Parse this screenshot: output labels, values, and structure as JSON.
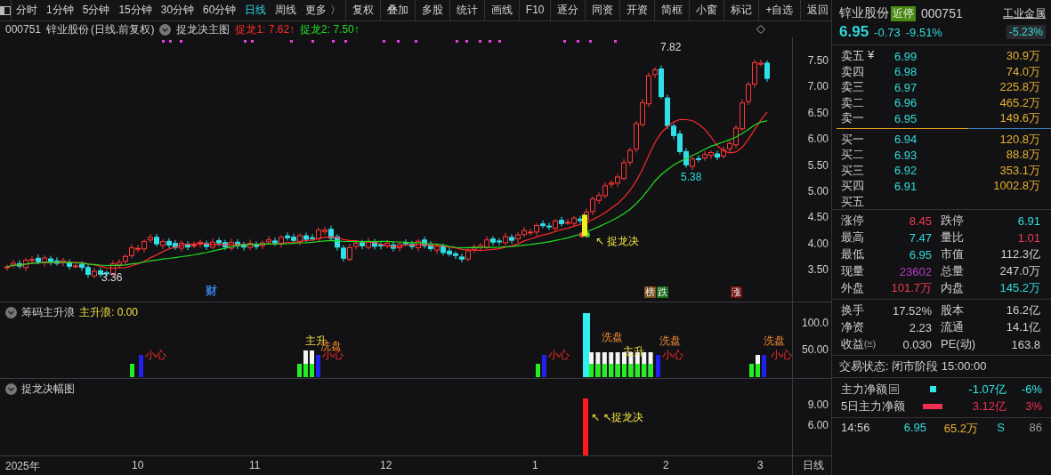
{
  "toolbar": {
    "periods": [
      {
        "label": "分时",
        "selected": false
      },
      {
        "label": "1分钟",
        "selected": false
      },
      {
        "label": "5分钟",
        "selected": false
      },
      {
        "label": "15分钟",
        "selected": false
      },
      {
        "label": "30分钟",
        "selected": false
      },
      {
        "label": "60分钟",
        "selected": false
      },
      {
        "label": "日线",
        "selected": true
      },
      {
        "label": "周线",
        "selected": false
      },
      {
        "label": "更多 〉",
        "selected": false
      }
    ],
    "buttons": [
      "复权",
      "叠加",
      "多股",
      "统计",
      "画线",
      "F10",
      "逐分",
      "同资",
      "开资",
      "简框",
      "小窗",
      "标记",
      "+自选",
      "返回"
    ]
  },
  "chart_header": {
    "code": "000751",
    "name": "锌业股份",
    "mode": "(日线.前复权)",
    "indicator": "捉龙决主图",
    "legend": [
      {
        "label": "捉龙1: 7.62↑",
        "color": "#ff2a2a"
      },
      {
        "label": "捉龙2: 7.50↑",
        "color": "#22dd22"
      }
    ]
  },
  "main_chart": {
    "yticks": [
      "7.50",
      "7.00",
      "6.50",
      "6.00",
      "5.50",
      "5.00",
      "4.50",
      "4.00",
      "3.50"
    ],
    "annotations": [
      {
        "text": "7.82"
      },
      {
        "text": "5.38"
      },
      {
        "text": "3.36"
      },
      {
        "text": "↖ 捉龙决"
      }
    ],
    "markers": [
      {
        "text": "财",
        "kind": "text",
        "color": "#3a7ee0"
      },
      {
        "text": "榜",
        "kind": "badge",
        "color": "#7a4e1c"
      },
      {
        "text": "跌",
        "kind": "badge",
        "color": "#1c6e1c"
      },
      {
        "text": "涨",
        "kind": "badge",
        "color": "#6e1010"
      }
    ]
  },
  "indicator_1": {
    "title": "筹码主升浪",
    "reading": "主升浪: 0.00",
    "yticks": [
      "100.0",
      "50.00"
    ],
    "labels": [
      {
        "text": "小心",
        "kind": "warn"
      },
      {
        "text": "主升",
        "kind": "rise"
      },
      {
        "text": "洗盘",
        "kind": "wash"
      },
      {
        "text": "小心",
        "kind": "warn"
      },
      {
        "text": "小心",
        "kind": "warn"
      },
      {
        "text": "洗盘",
        "kind": "wash"
      },
      {
        "text": "主升",
        "kind": "rise"
      },
      {
        "text": "洗盘",
        "kind": "wash"
      },
      {
        "text": "小心",
        "kind": "warn"
      },
      {
        "text": "洗盘",
        "kind": "wash"
      },
      {
        "text": "小心",
        "kind": "warn"
      }
    ]
  },
  "indicator_2": {
    "title": "捉龙决幅图",
    "yticks": [
      "9.00",
      "6.00"
    ],
    "annotation": "↖ ↖捉龙决"
  },
  "x_axis": {
    "labels": [
      "2025年",
      "10",
      "11",
      "12",
      "1",
      "2",
      "3"
    ],
    "period": "日线"
  },
  "quote": {
    "name": "锌业股份",
    "badge": "近停",
    "code": "000751",
    "sector": "工业金属",
    "sector_change": "-5.23%",
    "price": "6.95",
    "change": "-0.73",
    "percent": "-9.51%",
    "asks": [
      {
        "label": "卖五",
        "price": "6.99",
        "volume": "30.9万"
      },
      {
        "label": "卖四",
        "price": "6.98",
        "volume": "74.0万"
      },
      {
        "label": "卖三",
        "price": "6.97",
        "volume": "225.8万"
      },
      {
        "label": "卖二",
        "price": "6.96",
        "volume": "465.2万"
      },
      {
        "label": "卖一",
        "price": "6.95",
        "volume": "149.6万"
      }
    ],
    "currency_mark": "¥",
    "bids": [
      {
        "label": "买一",
        "price": "6.94",
        "volume": "120.8万"
      },
      {
        "label": "买二",
        "price": "6.93",
        "volume": "88.8万"
      },
      {
        "label": "买三",
        "price": "6.92",
        "volume": "353.1万"
      },
      {
        "label": "买四",
        "price": "6.91",
        "volume": "1002.8万"
      },
      {
        "label": "买五"
      }
    ],
    "stats_1": [
      {
        "label": "涨停",
        "value": "8.45",
        "color": "#f03a50"
      },
      {
        "label": "跌停",
        "value": "6.91",
        "color": "#30dada"
      },
      {
        "label": "最高",
        "value": "7.47",
        "color": "#30dada"
      },
      {
        "label": "量比",
        "value": "1.01",
        "color": "#f03a50"
      },
      {
        "label": "最低",
        "value": "6.95",
        "color": "#30dada"
      },
      {
        "label": "市值",
        "value": "112.3亿",
        "color": "#d0d0d0"
      },
      {
        "label": "现量",
        "value": "23602",
        "color": "#b040c0"
      },
      {
        "label": "总量",
        "value": "247.0万",
        "color": "#d0d0d0"
      },
      {
        "label": "外盘",
        "value": "101.7万",
        "color": "#f03a50"
      },
      {
        "label": "内盘",
        "value": "145.2万",
        "color": "#30dada"
      }
    ],
    "stats_2": [
      {
        "label": "换手",
        "value": "17.52%"
      },
      {
        "label": "股本",
        "value": "16.2亿"
      },
      {
        "label": "净资",
        "value": "2.23"
      },
      {
        "label": "流通",
        "value": "14.1亿"
      },
      {
        "label": "收益㈢",
        "value": "0.030"
      },
      {
        "label": "PE(动)",
        "value": "163.8"
      }
    ],
    "status": "交易状态: 闭市阶段 15:00:00",
    "flows": [
      {
        "label": "主力净额",
        "kind": "today",
        "color": "#30e8e8",
        "amount": "-1.07亿",
        "share": "-6%"
      },
      {
        "label": "5日主力净额",
        "kind": "five_day",
        "color": "#f03050",
        "amount": "3.12亿",
        "share": "3%"
      }
    ],
    "ticks": [
      {
        "time": "14:56",
        "price": "6.95",
        "volume": "65.2万",
        "side": "S",
        "count": "86"
      }
    ]
  }
}
